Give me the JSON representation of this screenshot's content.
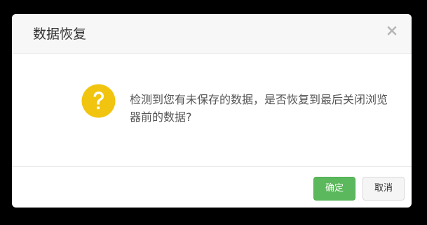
{
  "dialog": {
    "title": "数据恢复",
    "close_icon": "close-icon",
    "message_icon": "question-icon",
    "message": "检测到您有未保存的数据，是否恢复到最后关闭浏览器前的数据?",
    "confirm_label": "确定",
    "cancel_label": "取消"
  },
  "colors": {
    "icon": "#f1c40f",
    "confirm": "#5cb85c",
    "header": "#f7f7f7"
  }
}
